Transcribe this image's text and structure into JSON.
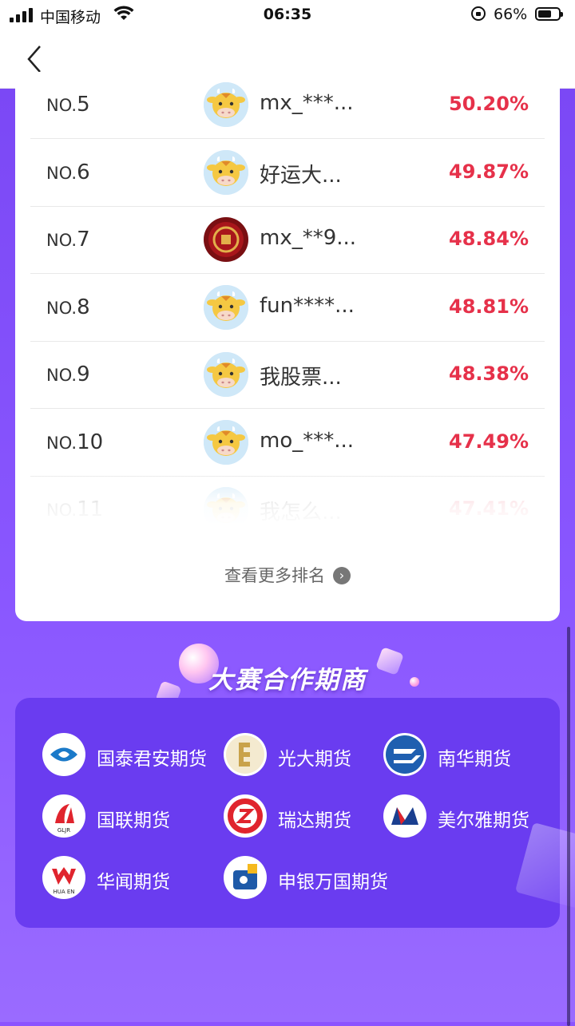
{
  "status_bar": {
    "carrier": "中国移动",
    "time": "06:35",
    "battery_text": "66%",
    "battery_level": 0.66
  },
  "header": {
    "back_icon": "chevron-left-icon"
  },
  "ranking": {
    "rows": [
      {
        "no": "NO.",
        "num": "5",
        "name": "mx_***...",
        "pct": "50.20%",
        "avatar": "cow"
      },
      {
        "no": "NO.",
        "num": "6",
        "name": "好运大...",
        "pct": "49.87%",
        "avatar": "cow"
      },
      {
        "no": "NO.",
        "num": "7",
        "name": "mx_**9...",
        "pct": "48.84%",
        "avatar": "red"
      },
      {
        "no": "NO.",
        "num": "8",
        "name": "fun****...",
        "pct": "48.81%",
        "avatar": "cow"
      },
      {
        "no": "NO.",
        "num": "9",
        "name": "我股票...",
        "pct": "48.38%",
        "avatar": "cow"
      },
      {
        "no": "NO.",
        "num": "10",
        "name": "mo_***...",
        "pct": "47.49%",
        "avatar": "cow"
      },
      {
        "no": "NO.",
        "num": "11",
        "name": "我怎么...",
        "pct": "47.41%",
        "avatar": "cow"
      }
    ],
    "more_label": "查看更多排名",
    "more_icon": "chevron-right-circle-icon"
  },
  "partners": {
    "title": "大赛合作期商",
    "items": [
      {
        "name": "国泰君安期货",
        "logo": "guotai-junan-logo"
      },
      {
        "name": "光大期货",
        "logo": "everbright-logo"
      },
      {
        "name": "南华期货",
        "logo": "nanhua-logo"
      },
      {
        "name": "国联期货",
        "logo": "guolian-logo",
        "logo_text": "GLJR"
      },
      {
        "name": "瑞达期货",
        "logo": "ruida-logo"
      },
      {
        "name": "美尔雅期货",
        "logo": "meierya-logo"
      },
      {
        "name": "华闻期货",
        "logo": "huawen-logo",
        "logo_text": "HUA EN"
      },
      {
        "name": "申银万国期货",
        "logo": "shenyin-wanguo-logo"
      }
    ]
  },
  "colors": {
    "accent_red": "#e6314a",
    "purple_bg": "#8b53ff",
    "partner_card": "#6a3cf0"
  }
}
